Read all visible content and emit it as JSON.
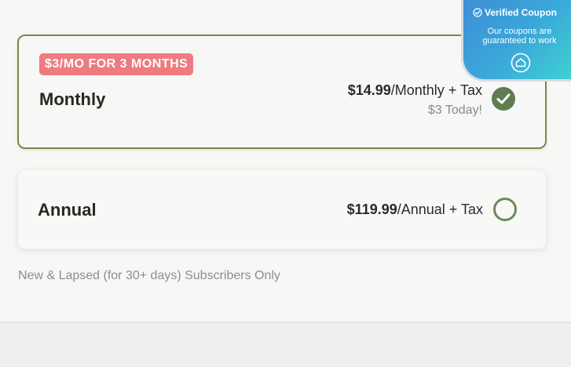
{
  "coupon": {
    "title": "Verified Coupon",
    "subtitle": "Our coupons are guaranteed to work",
    "check_icon": "check-circle-icon",
    "logo_icon": "home-outline-icon"
  },
  "plans": {
    "monthly": {
      "badge": "$3/MO FOR 3 MONTHS",
      "name": "Monthly",
      "price": "$14.99",
      "price_suffix": "/Monthly + Tax",
      "today_note": "$3 Today!",
      "selected": true
    },
    "annual": {
      "name": "Annual",
      "price": "$119.99",
      "price_suffix": "/Annual + Tax",
      "selected": false
    }
  },
  "eligibility_note": "New & Lapsed (for 30+ days) Subscribers Only",
  "colors": {
    "selected_border": "#7a8a3e",
    "badge_bg": "#ef7b7f",
    "radio": "#5e7c4f",
    "coupon_gradient_start": "#3f8ed6",
    "coupon_gradient_end": "#3fd0d2"
  }
}
